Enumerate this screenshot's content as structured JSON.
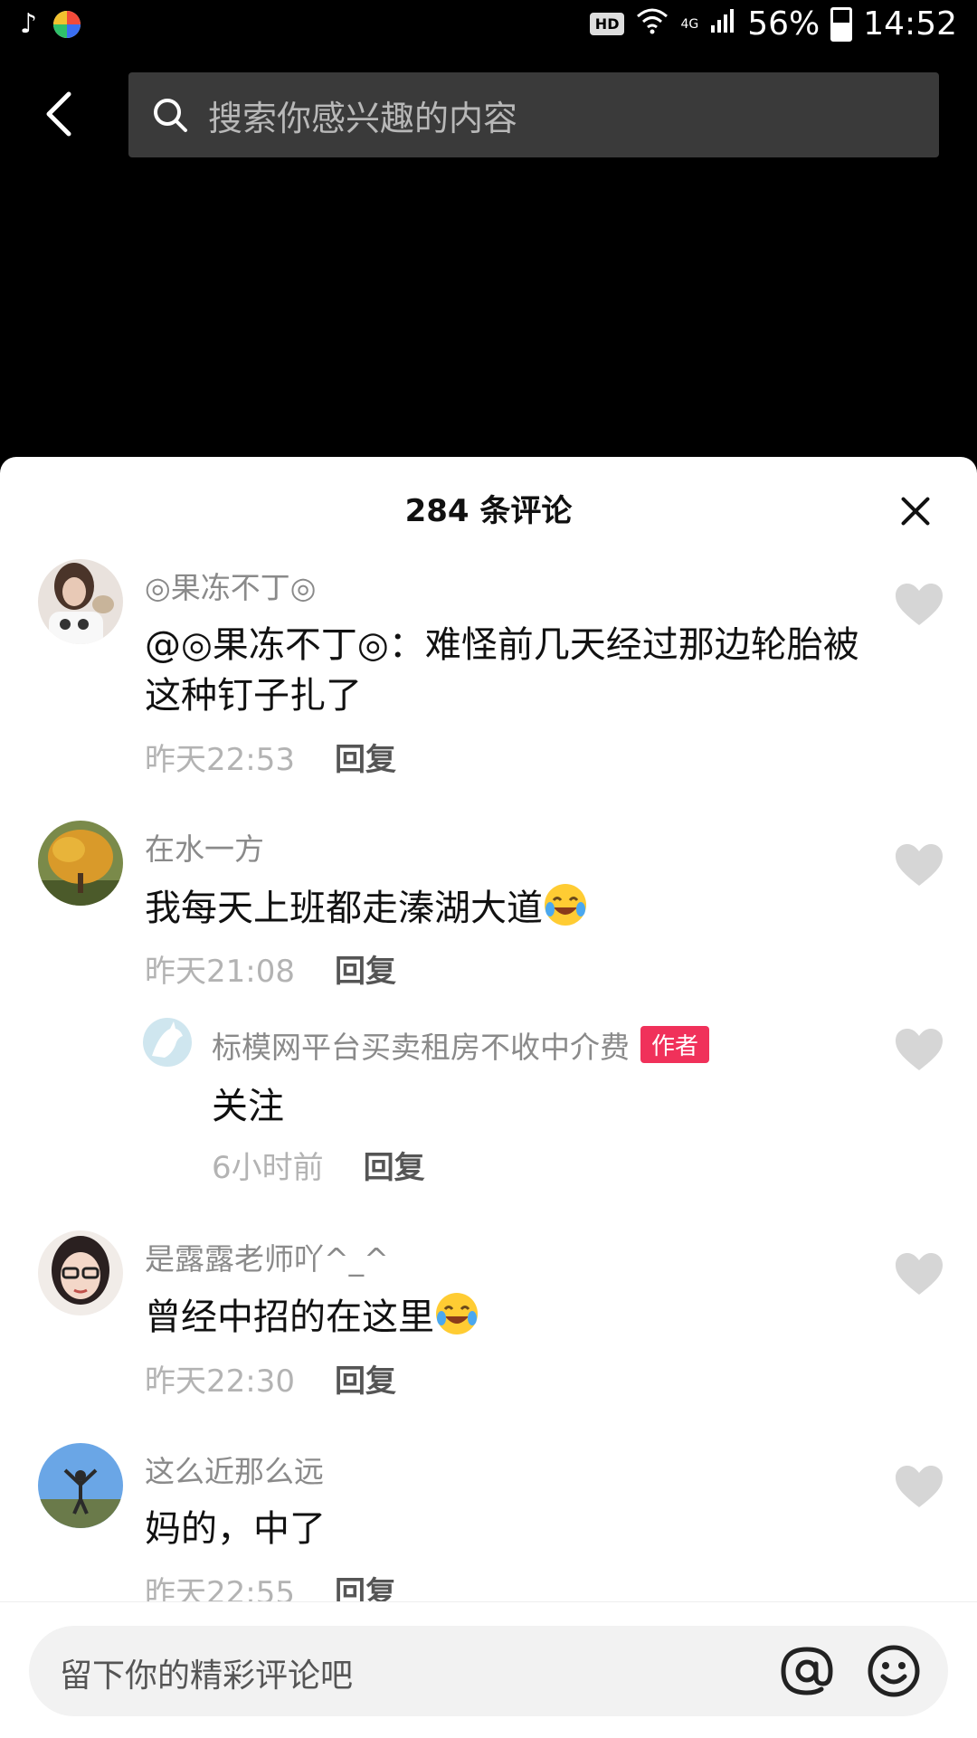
{
  "status_bar": {
    "network_type": "4G",
    "battery": "56%",
    "time": "14:52",
    "hd_label": "HD",
    "battery_level": 0.56
  },
  "header": {
    "search_placeholder": "搜索你感兴趣的内容"
  },
  "sheet": {
    "title": "284 条评论",
    "reply_label": "回复",
    "author_badge": "作者",
    "comments": [
      {
        "user": "◎果冻不丁◎",
        "text": "@◎果冻不丁◎：难怪前几天经过那边轮胎被这种钉子扎了",
        "time": "昨天22:53"
      },
      {
        "user": "在水一方",
        "text": "我每天上班都走溱湖大道",
        "time": "昨天21:08"
      },
      {
        "user": "标模网平台买卖租房不收中介费",
        "text": "关注",
        "time": "6小时前"
      },
      {
        "user": "是露露老师吖^_^",
        "text": "曾经中招的在这里",
        "time": "昨天22:30"
      },
      {
        "user": "这么近那么远",
        "text": "妈的，中了",
        "time": "昨天22:55"
      }
    ]
  },
  "input": {
    "placeholder": "留下你的精彩评论吧"
  },
  "colors": {
    "accent": "#f0315a",
    "sheet_bg": "#ffffff",
    "username": "#8a8a8a",
    "meta": "#b3b3b3"
  }
}
